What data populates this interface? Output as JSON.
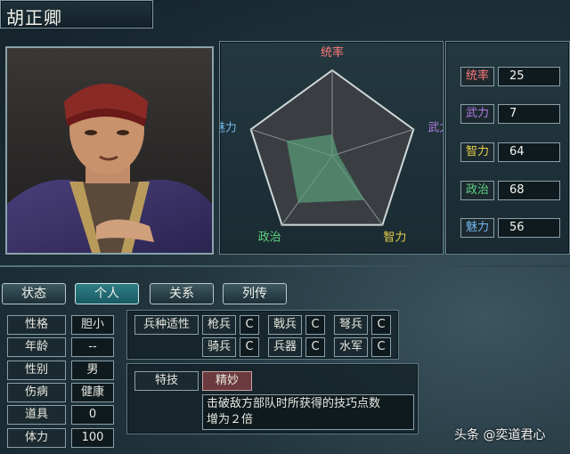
{
  "character": {
    "name": "胡正卿"
  },
  "radar": {
    "labels": {
      "tong": "统率",
      "wu": "武力",
      "zhi": "智力",
      "zheng": "政治",
      "mei": "魅力"
    },
    "colors": {
      "tong": "#ff7a7a",
      "wu": "#b07ae0",
      "zhi": "#e8d04a",
      "zheng": "#5fd07e",
      "mei": "#72b8ee"
    },
    "max": 100
  },
  "stats": [
    {
      "label": "统率",
      "value": "25",
      "color": "#ff7a7a"
    },
    {
      "label": "武力",
      "value": "7",
      "color": "#b07ae0"
    },
    {
      "label": "智力",
      "value": "64",
      "color": "#e8d04a"
    },
    {
      "label": "政治",
      "value": "68",
      "color": "#5fd07e"
    },
    {
      "label": "魅力",
      "value": "56",
      "color": "#72b8ee"
    }
  ],
  "tabs": [
    "状态",
    "个人",
    "关系",
    "列传"
  ],
  "info": [
    {
      "label": "性格",
      "value": "胆小"
    },
    {
      "label": "年龄",
      "value": "--"
    },
    {
      "label": "性别",
      "value": "男"
    },
    {
      "label": "伤病",
      "value": "健康"
    },
    {
      "label": "道具",
      "value": "0"
    },
    {
      "label": "体力",
      "value": "100"
    }
  ],
  "arms": {
    "title": "兵种适性",
    "items": [
      {
        "name": "枪兵",
        "grade": "C"
      },
      {
        "name": "戟兵",
        "grade": "C"
      },
      {
        "name": "弩兵",
        "grade": "C"
      },
      {
        "name": "骑兵",
        "grade": "C"
      },
      {
        "name": "兵器",
        "grade": "C"
      },
      {
        "name": "水军",
        "grade": "C"
      }
    ]
  },
  "skill": {
    "title": "特技",
    "name": "精妙",
    "desc_line1": "击破敌方部队时所获得的技巧点数",
    "desc_line2": "增为２倍"
  },
  "watermark": "头条 @奕道君心"
}
